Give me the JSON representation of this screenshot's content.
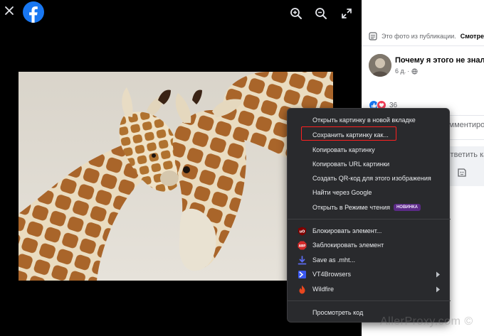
{
  "viewer": {
    "close_icon": "close-icon",
    "logo": "facebook-logo",
    "tools": [
      "zoom-in-icon",
      "zoom-out-icon",
      "fullscreen-icon"
    ]
  },
  "post": {
    "info_text": "Это фото из публикации.",
    "info_link": "Смотреть",
    "title": "Почему я этого не знал?",
    "time": "6 д.",
    "reaction_count": "36",
    "comment_label": "Комментировать",
    "comment_placeholder": "Ответить как Эльвира"
  },
  "context_menu": {
    "group1": [
      {
        "label": "Открыть картинку в новой вкладке"
      },
      {
        "label": "Сохранить картинку как...",
        "highlighted": true
      },
      {
        "label": "Копировать картинку"
      },
      {
        "label": "Копировать URL картинки"
      },
      {
        "label": "Создать QR-код для этого изображения"
      },
      {
        "label": "Найти через Google"
      },
      {
        "label": "Открыть в Режиме чтения",
        "badge": "НОВИНКА"
      }
    ],
    "group2": [
      {
        "label": "Блокировать элемент...",
        "icon": "ublock-origin-icon"
      },
      {
        "label": "Заблокировать элемент",
        "icon": "adblock-plus-icon"
      },
      {
        "label": "Save as .mht...",
        "icon": "download-icon"
      },
      {
        "label": "VT4Browsers",
        "icon": "virustotal-icon",
        "submenu": true
      },
      {
        "label": "Wildfire",
        "icon": "wildfire-icon",
        "submenu": true
      }
    ],
    "group3": [
      {
        "label": "Просмотреть код"
      }
    ]
  },
  "watermark": "AllerProxy.com ©",
  "colors": {
    "highlight": "#ff2020",
    "menu_bg": "#292a2d",
    "facebook_blue": "#1877f2",
    "badge": "#5b2a86"
  }
}
